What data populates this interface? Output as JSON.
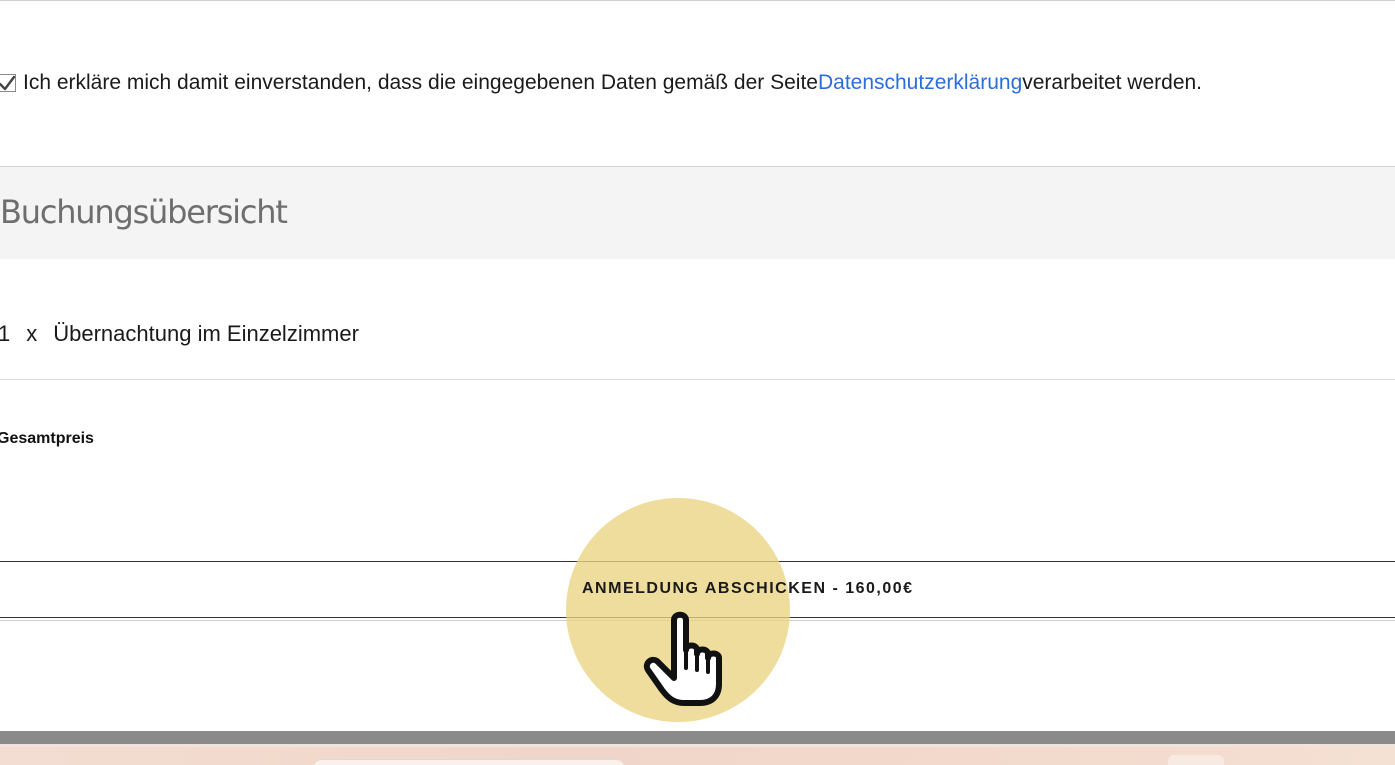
{
  "consent": {
    "checked": true,
    "text_before": "Ich erkläre mich damit einverstanden, dass die eingegebenen Daten gemäß der Seite ",
    "link_text": "Datenschutzerklärung",
    "text_after": " verarbeitet werden."
  },
  "overview": {
    "title": "Buchungsübersicht",
    "items": [
      {
        "quantity": "1",
        "separator": "x",
        "name": "Übernachtung im Einzelzimmer"
      }
    ],
    "total_label": "Gesamtpreis"
  },
  "submit": {
    "label": "ANMELDUNG ABSCHICKEN - 160,00€"
  },
  "colors": {
    "link": "#2a6edb",
    "highlight": "#e9d380",
    "header_bg": "#f4f4f4"
  },
  "icons": {
    "checkbox": "checkmark-icon",
    "cursor": "hand-pointer-icon"
  }
}
